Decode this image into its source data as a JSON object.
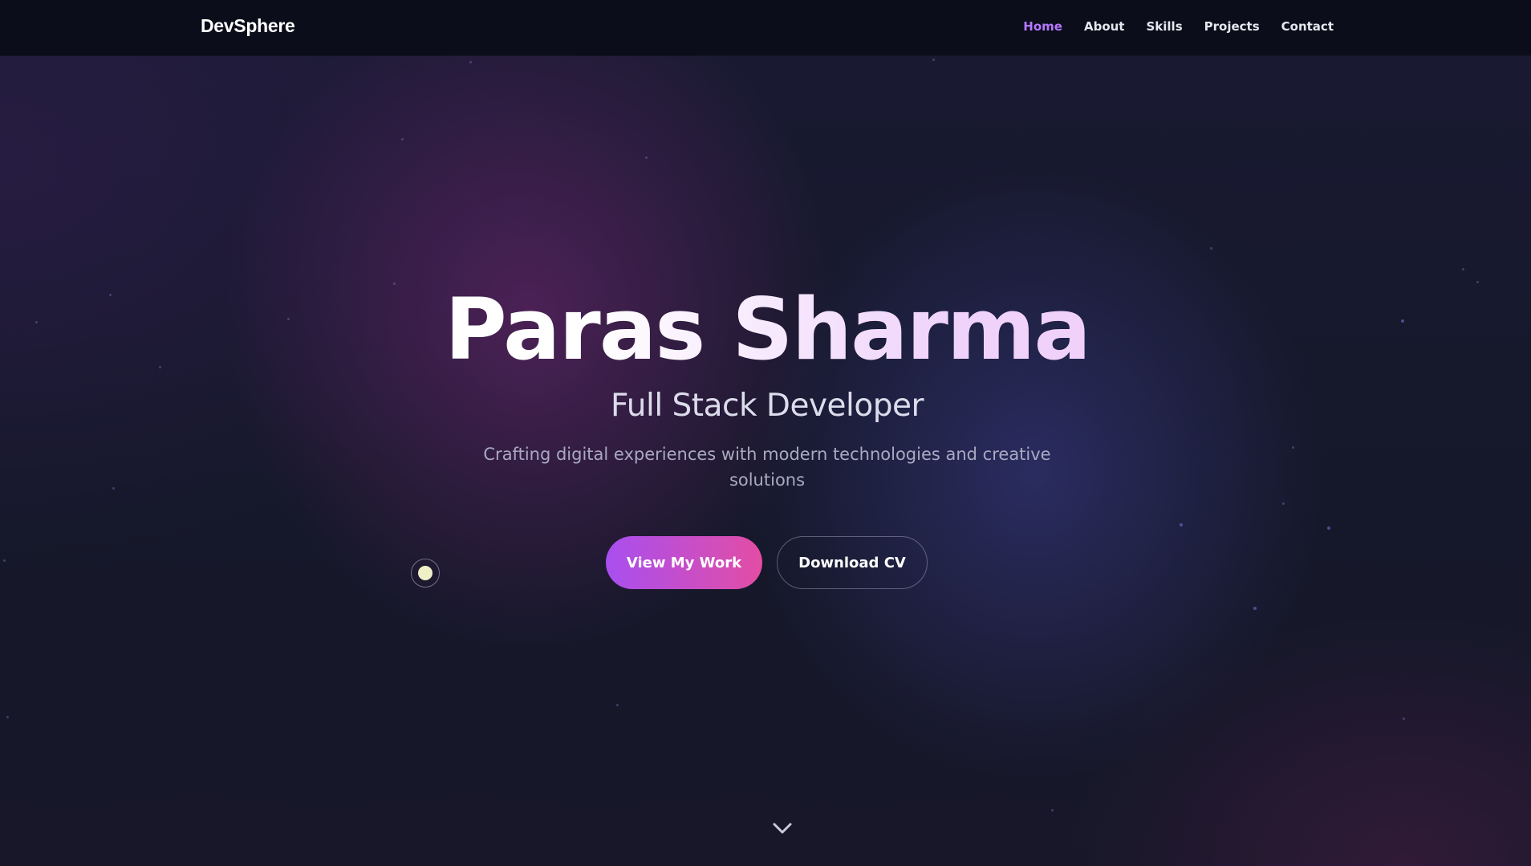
{
  "navbar": {
    "brand": "DevSphere",
    "links": [
      {
        "label": "Home",
        "active": true
      },
      {
        "label": "About",
        "active": false
      },
      {
        "label": "Skills",
        "active": false
      },
      {
        "label": "Projects",
        "active": false
      },
      {
        "label": "Contact",
        "active": false
      }
    ]
  },
  "hero": {
    "name": "Paras Sharma",
    "role": "Full Stack Developer",
    "description": "Crafting digital experiences with modern technologies and creative solutions",
    "primary_button": "View My Work",
    "secondary_button": "Download CV"
  },
  "icons": {
    "scroll_indicator": "chevron-down-icon",
    "cursor": "cursor-follower-dot"
  },
  "colors": {
    "accent": "#b678ff",
    "gradient_start": "#a84ff0",
    "gradient_end": "#e34da4",
    "background": "#15182a"
  }
}
